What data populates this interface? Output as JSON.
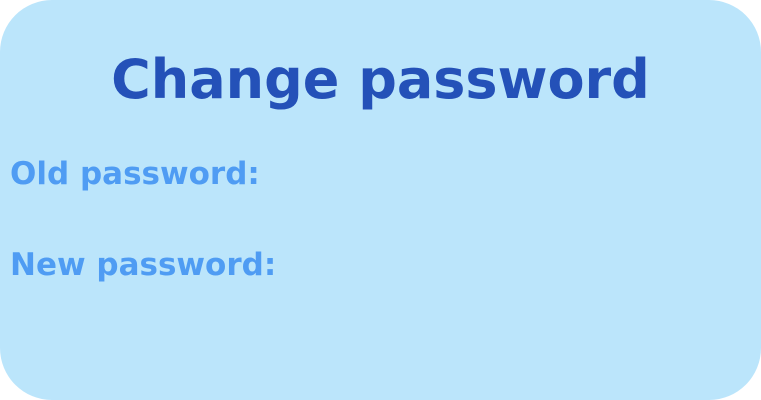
{
  "dialog": {
    "title": "Change password",
    "old_password": {
      "label": "Old password:",
      "value": ""
    },
    "new_password": {
      "label": "New password:",
      "value": ""
    }
  },
  "colors": {
    "background": "#bbe5fb",
    "title": "#2451b8",
    "label": "#4f9cf3"
  }
}
